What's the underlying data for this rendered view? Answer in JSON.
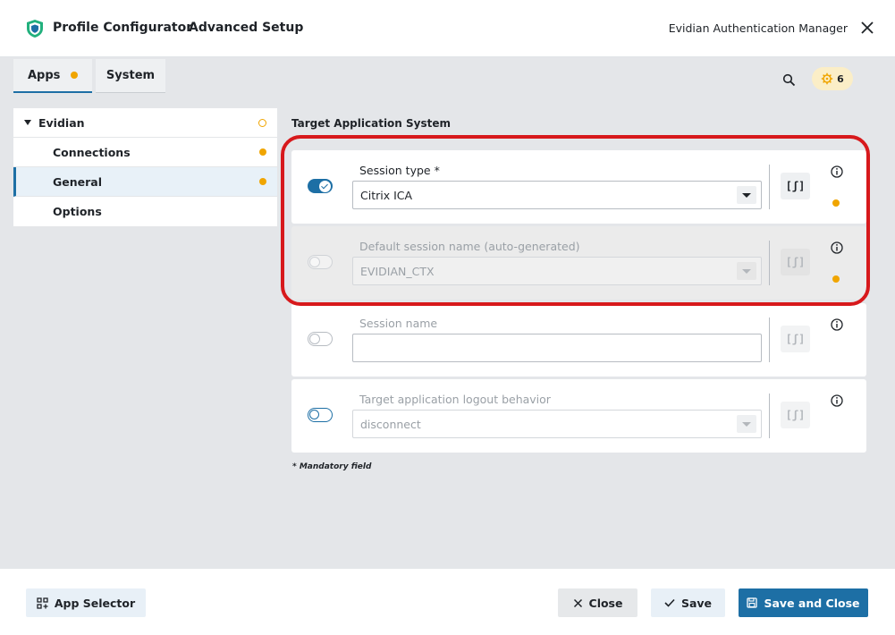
{
  "header": {
    "title": "Profile Configurator",
    "subtitle": "Advanced Setup",
    "product": "Evidian Authentication Manager"
  },
  "tabs": [
    {
      "label": "Apps",
      "active": true,
      "has_changes": true
    },
    {
      "label": "System",
      "active": false,
      "has_changes": false
    }
  ],
  "toolbar": {
    "notification_count": "6"
  },
  "tree": {
    "root": {
      "label": "Evidian",
      "expanded": true
    },
    "items": [
      {
        "label": "Connections",
        "selected": false
      },
      {
        "label": "General",
        "selected": true
      },
      {
        "label": "Options",
        "selected": false
      }
    ]
  },
  "section": {
    "title": "Target Application System",
    "fields": [
      {
        "label": "Session type *",
        "value": "Citrix ICA",
        "toggle": "on",
        "enabled": true,
        "fx": "[ʃ]"
      },
      {
        "label": "Default session name (auto-generated)",
        "value": "EVIDIAN_CTX",
        "toggle": "off",
        "enabled": false,
        "fx": "[ʃ]"
      },
      {
        "label": "Session name",
        "value": "",
        "toggle": "off",
        "enabled": true,
        "fx": "[ʃ]"
      },
      {
        "label": "Target application logout behavior",
        "value": "disconnect",
        "toggle": "outline",
        "enabled": true,
        "fx": "[ʃ]"
      }
    ],
    "mandatory_note": "* Mandatory field"
  },
  "footer": {
    "app_selector": "App Selector",
    "close": "Close",
    "save": "Save",
    "save_and_close": "Save and Close"
  },
  "colors": {
    "accent": "#1d6fa5",
    "indicator": "#f0a500",
    "highlight": "#d7191c"
  }
}
